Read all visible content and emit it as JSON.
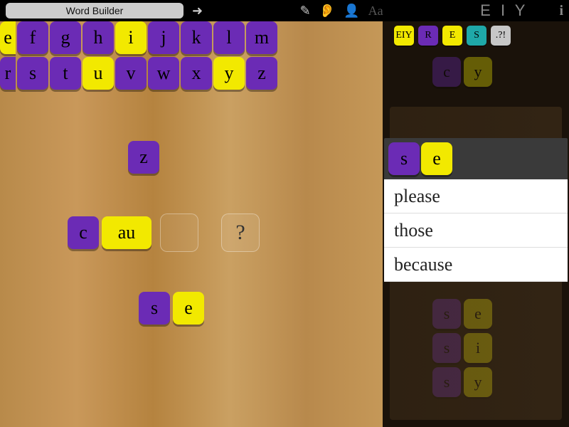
{
  "header": {
    "title": "Word Builder",
    "brand": "E I Y"
  },
  "alpha": {
    "row1": [
      {
        "l": "e",
        "c": "yellow"
      },
      {
        "l": "f",
        "c": "purple"
      },
      {
        "l": "g",
        "c": "purple"
      },
      {
        "l": "h",
        "c": "purple"
      },
      {
        "l": "i",
        "c": "yellow"
      },
      {
        "l": "j",
        "c": "purple"
      },
      {
        "l": "k",
        "c": "purple"
      },
      {
        "l": "l",
        "c": "purple"
      },
      {
        "l": "m",
        "c": "purple"
      }
    ],
    "row2": [
      {
        "l": "r",
        "c": "purple"
      },
      {
        "l": "s",
        "c": "purple"
      },
      {
        "l": "t",
        "c": "purple"
      },
      {
        "l": "u",
        "c": "yellow"
      },
      {
        "l": "v",
        "c": "purple"
      },
      {
        "l": "w",
        "c": "purple"
      },
      {
        "l": "x",
        "c": "purple"
      },
      {
        "l": "y",
        "c": "yellow"
      },
      {
        "l": "z",
        "c": "purple"
      }
    ]
  },
  "board": {
    "z": "z",
    "c": "c",
    "au": "au",
    "q": "?",
    "s": "s",
    "e": "e"
  },
  "cats": [
    {
      "l": "EIY",
      "c": "yellow"
    },
    {
      "l": "R",
      "c": "purple"
    },
    {
      "l": "E",
      "c": "yellow"
    },
    {
      "l": "S",
      "c": "teal"
    },
    {
      "l": ".?!",
      "c": "grayt"
    }
  ],
  "side_tiles": {
    "cy": [
      {
        "l": "c",
        "c": "purple"
      },
      {
        "l": "y",
        "c": "yellow"
      }
    ],
    "se": [
      {
        "l": "s",
        "c": "purple"
      },
      {
        "l": "e",
        "c": "yellow"
      }
    ],
    "si": [
      {
        "l": "s",
        "c": "purple"
      },
      {
        "l": "i",
        "c": "yellow"
      }
    ],
    "sy": [
      {
        "l": "s",
        "c": "purple"
      },
      {
        "l": "y",
        "c": "yellow"
      }
    ]
  },
  "panel": {
    "head": [
      {
        "l": "s",
        "c": "purple"
      },
      {
        "l": "e",
        "c": "yellow"
      }
    ],
    "words": [
      "please",
      "those",
      "because"
    ]
  }
}
